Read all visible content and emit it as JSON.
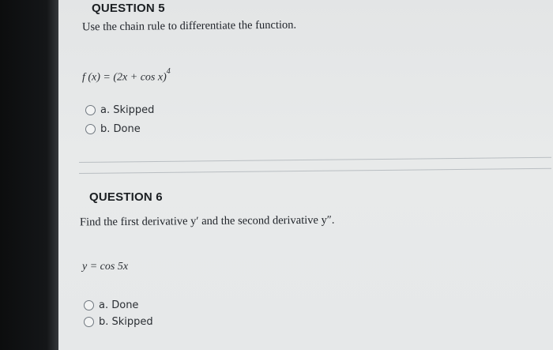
{
  "question5": {
    "title": "QUESTION 5",
    "prompt": "Use the chain rule to differentiate the function.",
    "formula_lhs": "f (x) = (2x + cos x)",
    "formula_exp": "4",
    "options": [
      {
        "label": "a. Skipped"
      },
      {
        "label": "b. Done"
      }
    ]
  },
  "question6": {
    "title": "QUESTION 6",
    "prompt": "Find the first derivative y′ and the second derivative y″.",
    "formula": "y = cos 5x",
    "options": [
      {
        "label": "a. Done"
      },
      {
        "label": "b. Skipped"
      }
    ]
  }
}
